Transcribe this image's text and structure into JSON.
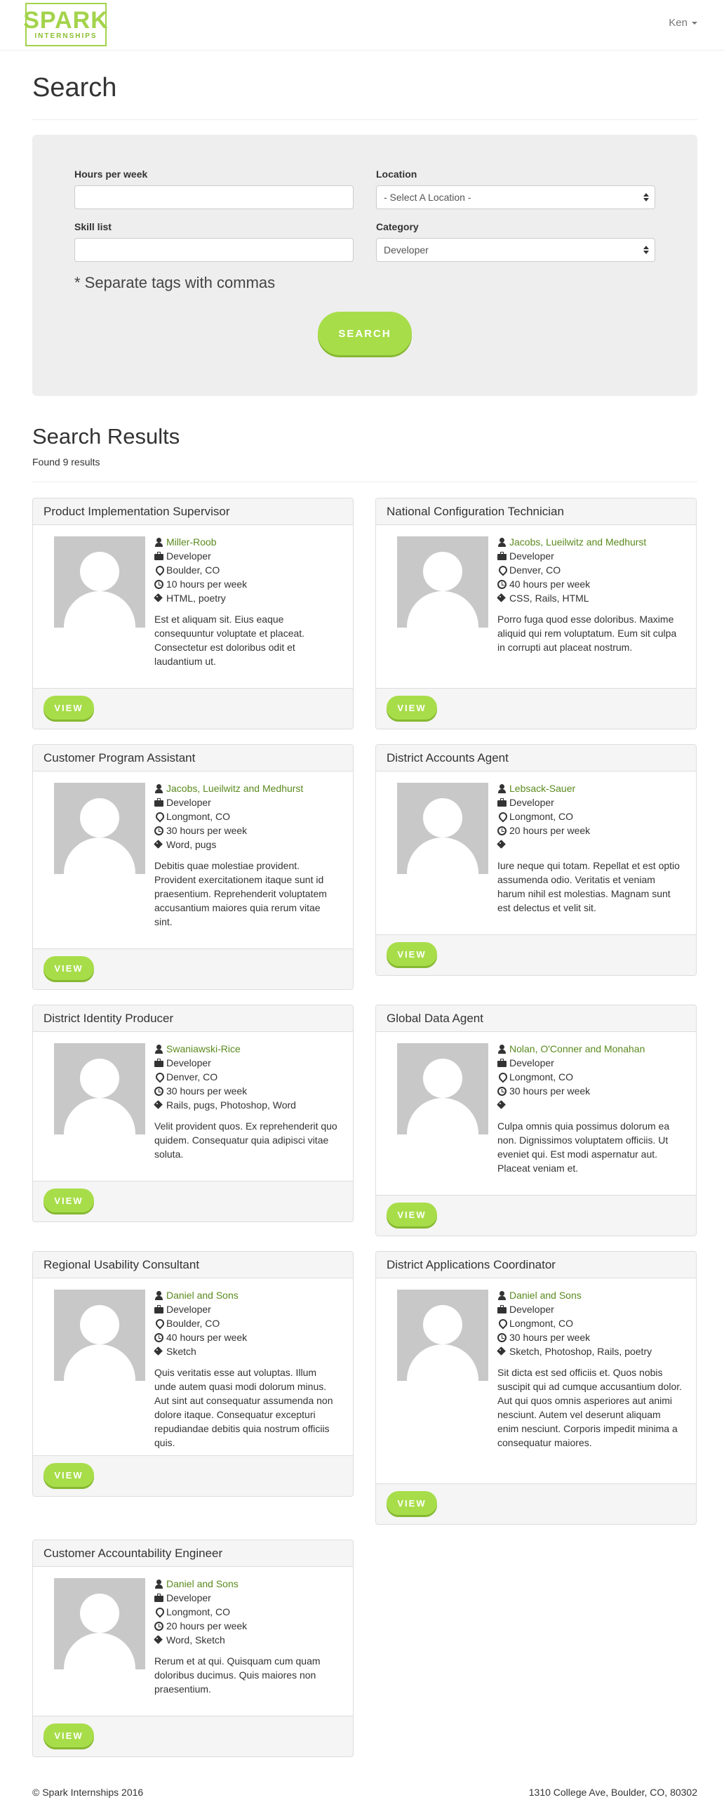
{
  "navbar": {
    "logo_main": "SPARK",
    "logo_sub": "INTERNSHIPS",
    "user": "Ken"
  },
  "page": {
    "title": "Search"
  },
  "search": {
    "hours_label": "Hours per week",
    "hours_value": "",
    "location_label": "Location",
    "location_selected": "- Select A Location -",
    "skills_label": "Skill list",
    "skills_value": "",
    "category_label": "Category",
    "category_selected": "Developer",
    "hint": "* Separate tags with commas",
    "button_label": "SEARCH"
  },
  "results": {
    "title": "Search Results",
    "count": "Found 9 results",
    "view_label": "VIEW",
    "cards": [
      {
        "title": "Product Implementation Supervisor",
        "company": "Miller-Roob",
        "category": "Developer",
        "location": "Boulder, CO",
        "hours": "10 hours per week",
        "skills": "HTML, poetry",
        "description": "Est et aliquam sit. Eius eaque consequuntur voluptate et placeat. Consectetur est doloribus odit et laudantium ut."
      },
      {
        "title": "National Configuration Technician",
        "company": "Jacobs, Lueilwitz and Medhurst",
        "category": "Developer",
        "location": "Denver, CO",
        "hours": "40 hours per week",
        "skills": "CSS, Rails, HTML",
        "description": "Porro fuga quod esse doloribus. Maxime aliquid qui rem voluptatum. Eum sit culpa in corrupti aut placeat nostrum."
      },
      {
        "title": "Customer Program Assistant",
        "company": "Jacobs, Lueilwitz and Medhurst",
        "category": "Developer",
        "location": "Longmont, CO",
        "hours": "30 hours per week",
        "skills": "Word, pugs",
        "description": "Debitis quae molestiae provident. Provident exercitationem itaque sunt id praesentium. Reprehenderit voluptatem accusantium maiores quia rerum vitae sint."
      },
      {
        "title": "District Accounts Agent",
        "company": "Lebsack-Sauer",
        "category": "Developer",
        "location": "Longmont, CO",
        "hours": "20 hours per week",
        "skills": "",
        "description": "Iure neque qui totam. Repellat et est optio assumenda odio. Veritatis et veniam harum nihil est molestias. Magnam sunt est delectus et velit sit."
      },
      {
        "title": "District Identity Producer",
        "company": "Swaniawski-Rice",
        "category": "Developer",
        "location": "Denver, CO",
        "hours": "30 hours per week",
        "skills": "Rails, pugs, Photoshop, Word",
        "description": "Velit provident quos. Ex reprehenderit quo quidem. Consequatur quia adipisci vitae soluta."
      },
      {
        "title": "Global Data Agent",
        "company": "Nolan, O'Conner and Monahan",
        "category": "Developer",
        "location": "Longmont, CO",
        "hours": "30 hours per week",
        "skills": "",
        "description": "Culpa omnis quia possimus dolorum ea non. Dignissimos voluptatem officiis. Ut eveniet qui. Est modi aspernatur aut. Placeat veniam et."
      },
      {
        "title": "Regional Usability Consultant",
        "company": "Daniel and Sons",
        "category": "Developer",
        "location": "Boulder, CO",
        "hours": "40 hours per week",
        "skills": "Sketch",
        "description": "Quis veritatis esse aut voluptas. Illum unde autem quasi modi dolorum minus. Aut sint aut consequatur assumenda non dolore itaque. Consequatur excepturi repudiandae debitis quia nostrum officiis quis."
      },
      {
        "title": "District Applications Coordinator",
        "company": "Daniel and Sons",
        "category": "Developer",
        "location": "Longmont, CO",
        "hours": "30 hours per week",
        "skills": "Sketch, Photoshop, Rails, poetry",
        "description": "Sit dicta est sed officiis et. Quos nobis suscipit qui ad cumque accusantium dolor. Aut qui quos omnis asperiores aut animi nesciunt. Autem vel deserunt aliquam enim nesciunt. Corporis impedit minima a consequatur maiores."
      },
      {
        "title": "Customer Accountability Engineer",
        "company": "Daniel and Sons",
        "category": "Developer",
        "location": "Longmont, CO",
        "hours": "20 hours per week",
        "skills": "Word, Sketch",
        "description": "Rerum et at qui. Quisquam cum quam doloribus ducimus. Quis maiores non praesentium."
      }
    ]
  },
  "footer": {
    "copyright": "© Spark Internships 2016",
    "address": "1310 College Ave, Boulder, CO, 80302"
  }
}
